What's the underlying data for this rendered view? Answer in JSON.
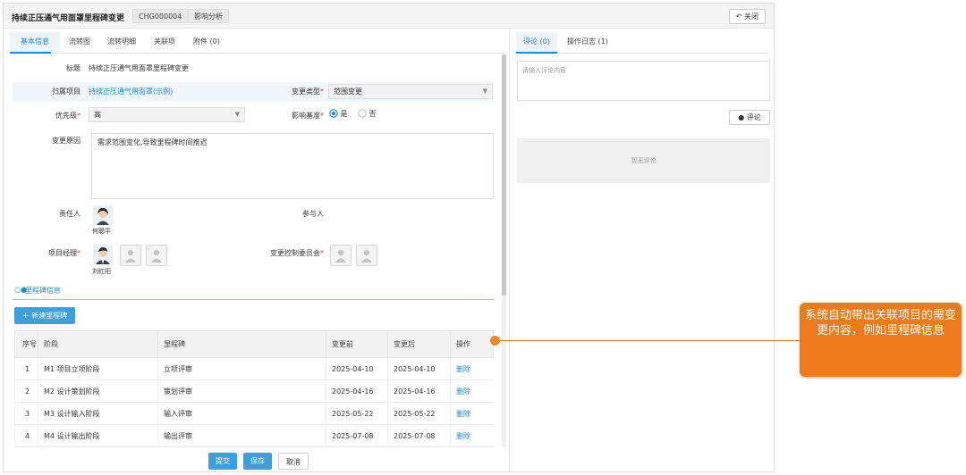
{
  "header": {
    "title": "持续正压通气用面罩里程碑变更",
    "code": "CHG000004",
    "impact_btn": "影响分析",
    "close_btn": "关闭"
  },
  "tabs": [
    "基本信息",
    "流转图",
    "流转明细",
    "关联项",
    "附件 (0)"
  ],
  "form": {
    "title_label": "标题",
    "title_value": "持续正压通气用面罩里程碑变更",
    "project_label": "归属项目",
    "project_value": "持续正压通气用面罩(示例)",
    "change_type_label": "变更类型",
    "change_type_value": "范围变更",
    "priority_label": "优先级",
    "priority_value": "高",
    "baseline_label": "影响基准",
    "baseline_yes": "是",
    "baseline_no": "否",
    "reason_label": "变更原因",
    "reason_value": "需求范围变化,导致里程碑时间推迟",
    "owner_label": "责任人",
    "owner_name": "何聪平",
    "participants_label": "参与人",
    "pm_label": "项目经理",
    "pm_name": "刘红阳",
    "ccb_label": "变更控制委员会"
  },
  "milestone": {
    "section_title": "里程碑信息",
    "new_btn": "新建里程碑",
    "columns": [
      "序号",
      "阶段",
      "里程碑",
      "变更前",
      "变更后",
      "操作"
    ],
    "rows": [
      {
        "no": "1",
        "phase": "M1 项目立项阶段",
        "milestone": "立项评审",
        "before": "2025-04-10",
        "after": "2025-04-10",
        "op": "删除"
      },
      {
        "no": "2",
        "phase": "M2 设计策划阶段",
        "milestone": "策划评审",
        "before": "2025-04-16",
        "after": "2025-04-16",
        "op": "删除"
      },
      {
        "no": "3",
        "phase": "M3 设计输入阶段",
        "milestone": "输入评审",
        "before": "2025-05-22",
        "after": "2025-05-22",
        "op": "删除"
      },
      {
        "no": "4",
        "phase": "M4 设计输出阶段",
        "milestone": "输出评审",
        "before": "2025-07-08",
        "after": "2025-07-08",
        "op": "删除"
      }
    ]
  },
  "actions": {
    "submit": "提交",
    "save": "保存",
    "cancel": "取消"
  },
  "right": {
    "tab_comment": "评论 (0)",
    "tab_log": "操作日志 (1)",
    "placeholder": "请输入评论内容",
    "comment_btn": "评论",
    "empty": "暂无评论"
  },
  "callout": {
    "text": "系统自动带出关联项目的需变更内容，例如里程碑信息"
  },
  "colors": {
    "accent": "#1a8ad6",
    "callout": "#ef7a1a",
    "button": "#3d9fdf"
  }
}
